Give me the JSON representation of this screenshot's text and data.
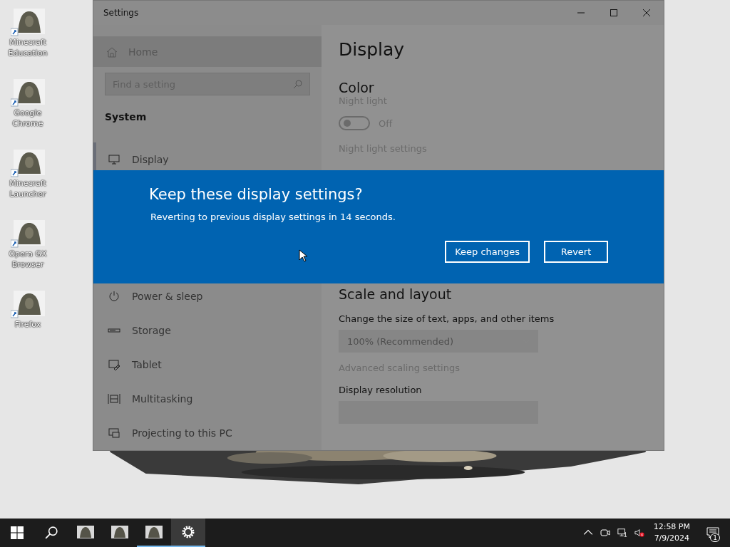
{
  "desktop_icons": [
    {
      "label": "Minecraft Education"
    },
    {
      "label": "Google Chrome"
    },
    {
      "label": "Minecraft Launcher"
    },
    {
      "label": "Opera GX Browser"
    },
    {
      "label": "Firefox"
    }
  ],
  "window": {
    "title": "Settings"
  },
  "sidebar": {
    "home": "Home",
    "search": {
      "placeholder": "Find a setting"
    },
    "section": "System",
    "items_top": [
      {
        "kind": "display",
        "label": "Display",
        "selected": true
      }
    ],
    "items_bottom": [
      {
        "kind": "power",
        "label": "Power & sleep",
        "selected": false
      },
      {
        "kind": "storage",
        "label": "Storage",
        "selected": false
      },
      {
        "kind": "tablet",
        "label": "Tablet",
        "selected": false
      },
      {
        "kind": "multitasking",
        "label": "Multitasking",
        "selected": false
      },
      {
        "kind": "projecting",
        "label": "Projecting to this PC",
        "selected": false
      }
    ]
  },
  "content": {
    "title": "Display",
    "color_heading": "Color",
    "night_light": {
      "label": "Night light",
      "on": false,
      "state_text": "Off"
    },
    "night_light_link": "Night light settings",
    "scale_heading": "Scale and layout",
    "scale_label": "Change the size of text, apps, and other items",
    "scale_value": "100% (Recommended)",
    "advanced_link": "Advanced scaling settings",
    "resolution_label": "Display resolution"
  },
  "dialog": {
    "title": "Keep these display settings?",
    "message": "Reverting to previous display settings in 14 seconds.",
    "buttons": [
      {
        "label": "Keep changes"
      },
      {
        "label": "Revert"
      }
    ]
  },
  "taskbar": {
    "apps": [
      {
        "kind": "shortcut",
        "running": false,
        "selected": false
      },
      {
        "kind": "shortcut",
        "running": false,
        "selected": false
      },
      {
        "kind": "shortcut",
        "running": true,
        "selected": false
      },
      {
        "kind": "settings",
        "running": true,
        "selected": true
      }
    ],
    "time": "12:58 PM",
    "date": "7/9/2024",
    "notification_count": "1"
  }
}
